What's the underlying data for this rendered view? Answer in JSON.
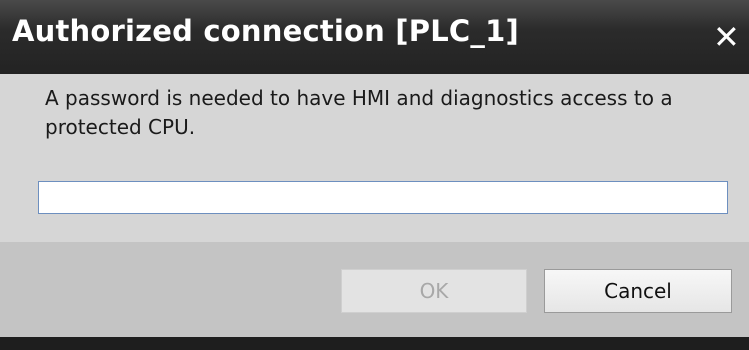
{
  "dialog": {
    "title": "Authorized connection [PLC_1]",
    "close_icon": "close-icon",
    "message": "A password is needed to have HMI and diagnostics access to a protected CPU.",
    "password_value": "",
    "buttons": {
      "ok_label": "OK",
      "cancel_label": "Cancel"
    }
  },
  "colors": {
    "titlebar": "#2b2b2b",
    "content_background": "#d6d6d6",
    "footer_background": "#c4c4c4",
    "input_border": "#6d8fbf",
    "disabled_text": "#a8a8a8"
  }
}
